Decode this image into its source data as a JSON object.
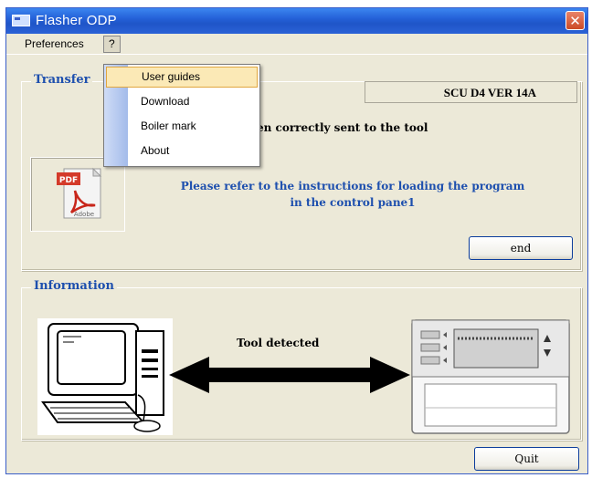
{
  "window": {
    "title": "Flasher ODP",
    "close_label": "✕"
  },
  "menubar": {
    "preferences": "Preferences",
    "help": "?"
  },
  "help_menu": {
    "items": [
      "User guides",
      "Download",
      "Boiler mark",
      "About"
    ],
    "selected_index": 0
  },
  "transfer": {
    "title": "Transfer",
    "version": "SCU D4 VER  14A",
    "status_message": "en correctly sent to the tool",
    "instructions_line1": "Please refer to the instructions for loading  the program",
    "instructions_line2": "in the control pane1",
    "pdf_icon_label": "PDF",
    "pdf_icon_brand": "Adobe",
    "end_button": "end"
  },
  "information": {
    "title": "Information",
    "tool_detected": "Tool detected"
  },
  "quit_button": "Quit",
  "colors": {
    "titlebar": "#2461d8",
    "accent_text": "#1d4fae",
    "window_bg": "#ece9d8"
  }
}
